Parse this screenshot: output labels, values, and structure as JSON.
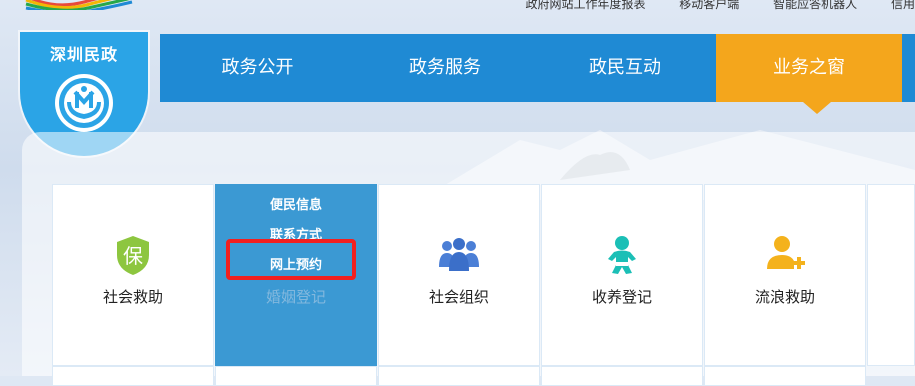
{
  "header": {
    "top_links": [
      "政府网站工作年度报表",
      "移动客户端",
      "智能应答机器人",
      "信用"
    ]
  },
  "badge": {
    "title": "深圳民政",
    "emblem_icon": "civil-affairs-hands-emblem-icon"
  },
  "nav": {
    "items": [
      {
        "label": "政务公开",
        "active": false
      },
      {
        "label": "政务服务",
        "active": false
      },
      {
        "label": "政民互动",
        "active": false
      },
      {
        "label": "业务之窗",
        "active": true
      }
    ]
  },
  "tiles": [
    {
      "label": "社会救助",
      "icon": "insurance-shield-icon"
    },
    {
      "label": "婚姻登记",
      "icon": "marriage-icon",
      "submenu": [
        "便民信息",
        "联系方式",
        "网上预约"
      ],
      "highlighted": "网上预约"
    },
    {
      "label": "社会组织",
      "icon": "people-group-icon"
    },
    {
      "label": "收养登记",
      "icon": "baby-icon"
    },
    {
      "label": "流浪救助",
      "icon": "user-add-icon"
    }
  ],
  "colors": {
    "nav_blue": "#1f8ad4",
    "active_orange": "#f4a61c",
    "badge_blue": "#2ba4e6",
    "highlight_red": "#f12020"
  }
}
